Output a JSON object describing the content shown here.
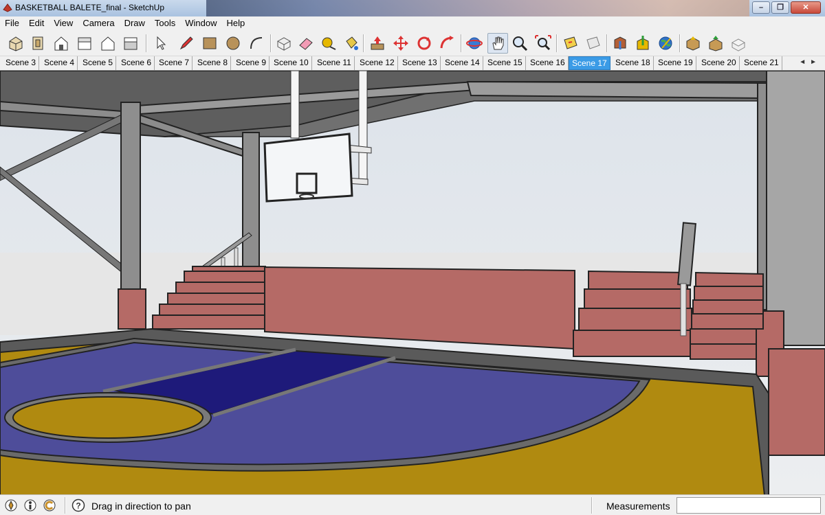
{
  "window": {
    "title": "BASKETBALL BALETE_final - SketchUp",
    "minimize_glyph": "–",
    "maximize_glyph": "❐",
    "close_glyph": "✕"
  },
  "menu": [
    "File",
    "Edit",
    "View",
    "Camera",
    "Draw",
    "Tools",
    "Window",
    "Help"
  ],
  "toolbar": {
    "icons": [
      "iso-view-icon",
      "top-view-icon",
      "front-view-icon",
      "right-view-icon",
      "back-view-icon",
      "left-view-icon",
      "select-icon",
      "pencil-icon",
      "rectangle-icon",
      "circle-icon",
      "arc-icon",
      "make-component-icon",
      "eraser-icon",
      "tape-measure-icon",
      "paint-bucket-icon",
      "push-pull-icon",
      "move-icon",
      "rotate-icon",
      "follow-me-icon",
      "orbit-icon",
      "pan-icon",
      "zoom-icon",
      "zoom-extents-icon",
      "section-plane-icon",
      "section-display-icon",
      "get-models-icon",
      "share-model-icon",
      "google-earth-icon",
      "get-components-icon",
      "share-component-icon",
      "extension-icon"
    ],
    "active_tool": "pan-icon"
  },
  "scenes": {
    "tabs": [
      "Scene 3",
      "Scene 4",
      "Scene 5",
      "Scene 6",
      "Scene 7",
      "Scene 8",
      "Scene 9",
      "Scene 10",
      "Scene 11",
      "Scene 12",
      "Scene 13",
      "Scene 14",
      "Scene 15",
      "Scene 16",
      "Scene 17",
      "Scene 18",
      "Scene 19",
      "Scene 20",
      "Scene 21"
    ],
    "active": "Scene 17",
    "scroll_left": "◄",
    "scroll_right": "►"
  },
  "status": {
    "hint": "Drag in direction to pan",
    "measurements_label": "Measurements",
    "measurements_value": "",
    "help_glyph": "?"
  },
  "colors": {
    "court_blue": "#4e4d9a",
    "paint_navy": "#1e1a7a",
    "court_gold": "#b08a10",
    "bleacher_brick": "#b56a66",
    "sky": "#e4e8ec",
    "active_tab": "#3b9be6"
  }
}
